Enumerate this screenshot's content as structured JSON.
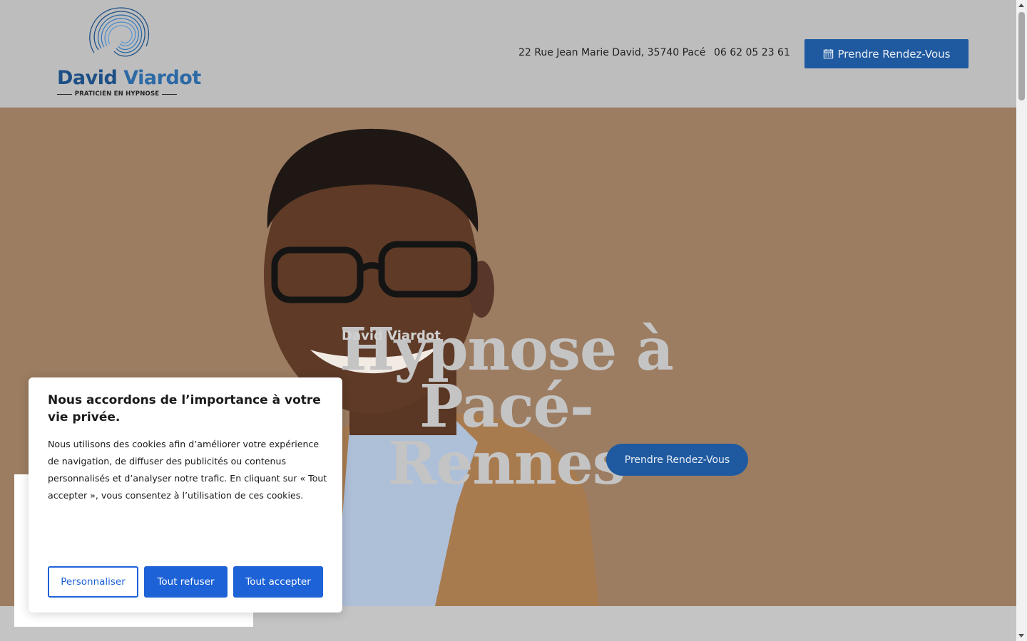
{
  "header": {
    "logo": {
      "name_part1": "David",
      "name_part2": "Viardot",
      "tagline": "PRATICIEN EN HYPNOSE"
    },
    "address": "22 Rue Jean Marie David, 35740 Pacé",
    "phone": "06 62 05 23 61",
    "cta_label": "Prendre Rendez-Vous",
    "cta_icon": "calendar-icon"
  },
  "hero": {
    "subtitle": "David Viardot",
    "title_line1": "Hypnose à Pacé-",
    "title_line2": "Rennes",
    "cta_label": "Prendre Rendez-Vous"
  },
  "cookie_banner": {
    "title": "Nous accordons de l’importance à votre vie privée.",
    "text": "Nous utilisons des cookies afin d’améliorer votre expérience de navigation, de diffuser des publicités ou contenus personnalisés et d’analyser notre trafic. En cliquant sur « Tout accepter », vous consentez à l’utilisation de ces cookies.",
    "btn_customize": "Personnaliser",
    "btn_refuse": "Tout refuser",
    "btn_accept": "Tout accepter"
  },
  "colors": {
    "header_bg": "#bdbdbd",
    "hero_bg": "#9c7d62",
    "brand_blue": "#1f5aa0",
    "cookie_blue": "#1d62d6"
  }
}
